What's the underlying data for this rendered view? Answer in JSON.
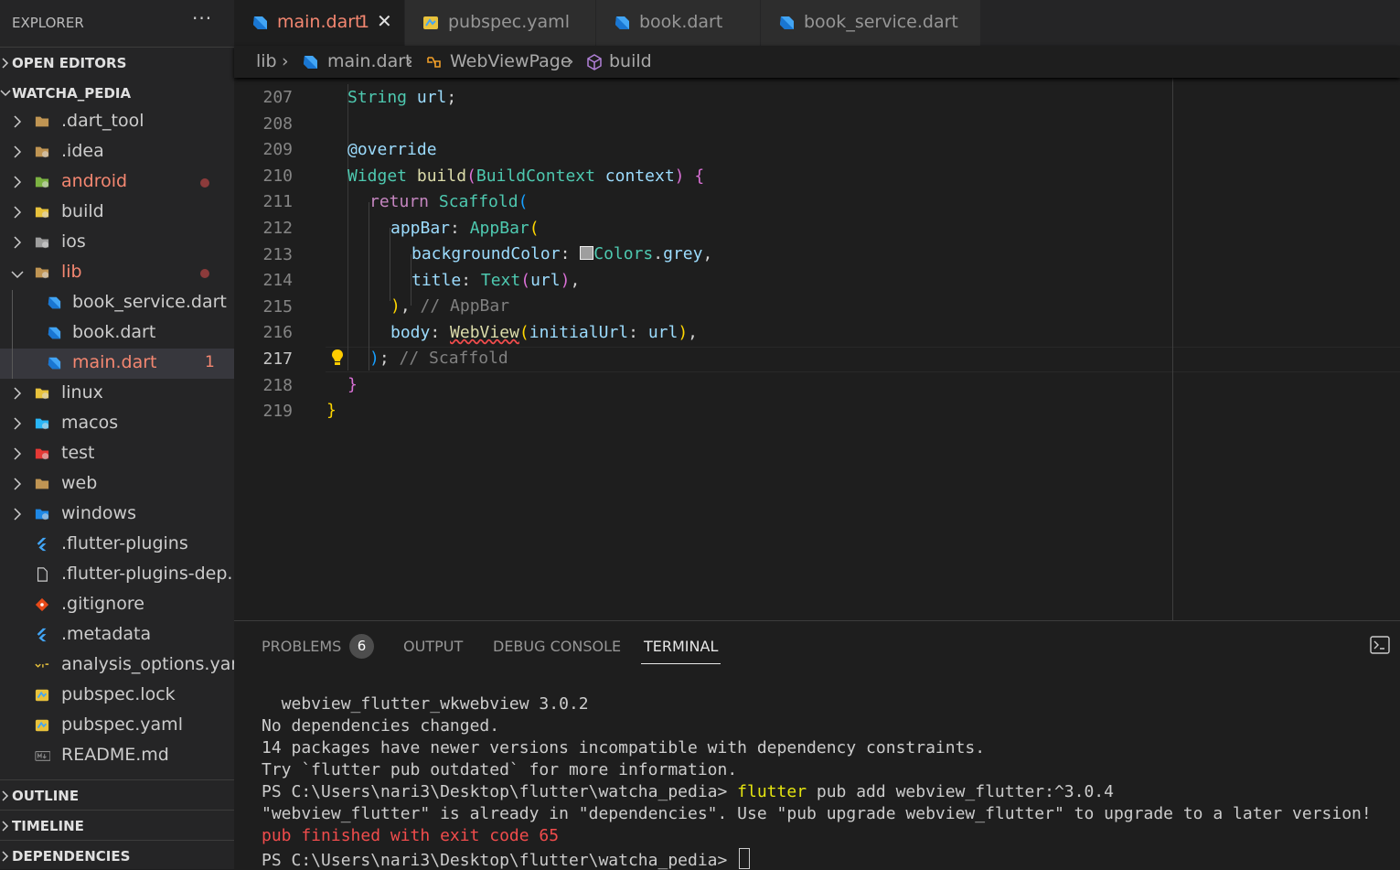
{
  "explorer": {
    "title": "EXPLORER",
    "more": "···",
    "open_editors": "OPEN EDITORS",
    "project": "WATCHA_PEDIA",
    "items": [
      {
        "name": ".dart_tool",
        "kind": "folder",
        "icon": "folder-icon",
        "color": "#c09553"
      },
      {
        "name": ".idea",
        "kind": "folder",
        "icon": "idea-folder-icon",
        "color": "#c09553"
      },
      {
        "name": "android",
        "kind": "folder",
        "icon": "android-folder-icon",
        "color": "#8bc34a",
        "modified": true
      },
      {
        "name": "build",
        "kind": "folder",
        "icon": "build-folder-icon",
        "color": "#e8c23c"
      },
      {
        "name": "ios",
        "kind": "folder",
        "icon": "ios-folder-icon",
        "color": "#9e9e9e"
      },
      {
        "name": "lib",
        "kind": "folder-open",
        "icon": "lib-folder-icon",
        "color": "#c09553",
        "modified": true
      },
      {
        "name": "book_service.dart",
        "kind": "file",
        "icon": "dart-icon"
      },
      {
        "name": "book.dart",
        "kind": "file",
        "icon": "dart-icon"
      },
      {
        "name": "main.dart",
        "kind": "file",
        "icon": "dart-icon",
        "errors": "1"
      },
      {
        "name": "linux",
        "kind": "folder",
        "icon": "linux-folder-icon"
      },
      {
        "name": "macos",
        "kind": "folder",
        "icon": "macos-folder-icon"
      },
      {
        "name": "test",
        "kind": "folder",
        "icon": "test-folder-icon"
      },
      {
        "name": "web",
        "kind": "folder",
        "icon": "web-folder-icon"
      },
      {
        "name": "windows",
        "kind": "folder",
        "icon": "windows-folder-icon"
      },
      {
        "name": ".flutter-plugins",
        "kind": "file",
        "icon": "flutter-icon"
      },
      {
        "name": ".flutter-plugins-dep...",
        "kind": "file",
        "icon": "file-icon"
      },
      {
        "name": ".gitignore",
        "kind": "file",
        "icon": "git-icon"
      },
      {
        "name": ".metadata",
        "kind": "file",
        "icon": "flutter-icon"
      },
      {
        "name": "analysis_options.yaml",
        "kind": "file",
        "icon": "yaml-icon"
      },
      {
        "name": "pubspec.lock",
        "kind": "file",
        "icon": "pubspec-icon"
      },
      {
        "name": "pubspec.yaml",
        "kind": "file",
        "icon": "pubspec-icon"
      },
      {
        "name": "README.md",
        "kind": "file",
        "icon": "markdown-icon"
      }
    ],
    "outline": "OUTLINE",
    "timeline": "TIMELINE",
    "dependencies": "DEPENDENCIES"
  },
  "tabs": [
    {
      "label": "main.dart",
      "badge": "1",
      "icon": "dart-icon",
      "active": true
    },
    {
      "label": "pubspec.yaml",
      "icon": "pubspec-icon"
    },
    {
      "label": "book.dart",
      "icon": "dart-icon"
    },
    {
      "label": "book_service.dart",
      "icon": "dart-icon"
    }
  ],
  "breadcrumb": [
    "lib",
    "main.dart",
    "WebViewPage",
    "build"
  ],
  "editor": {
    "line_numbers": [
      "207",
      "208",
      "209",
      "210",
      "211",
      "212",
      "213",
      "214",
      "215",
      "216",
      "217",
      "218",
      "219"
    ],
    "current_line": "217",
    "lines": [
      "String url;",
      "",
      "@override",
      "Widget build(BuildContext context) {",
      "return Scaffold(",
      "appBar: AppBar(",
      "backgroundColor: Colors.grey,",
      "title: Text(url),",
      "), // AppBar",
      "body: WebView(initialUrl: url),",
      "); // Scaffold",
      "}",
      "}"
    ]
  },
  "panel": {
    "tabs": [
      "PROBLEMS",
      "OUTPUT",
      "DEBUG CONSOLE",
      "TERMINAL"
    ],
    "problems_count": "6",
    "active_tab": "TERMINAL",
    "terminal_lines": [
      "  webview_flutter_wkwebview 3.0.2",
      "No dependencies changed.",
      "14 packages have newer versions incompatible with dependency constraints.",
      "Try `flutter pub outdated` for more information.",
      "PS C:\\Users\\nari3\\Desktop\\flutter\\watcha_pedia> ",
      "flutter",
      " pub add webview_flutter:^3.0.4",
      "\"webview_flutter\" is already in \"dependencies\". Use \"pub upgrade webview_flutter\" to upgrade to a later version!",
      "pub finished with exit code 65",
      "PS C:\\Users\\nari3\\Desktop\\flutter\\watcha_pedia> "
    ]
  },
  "colors": {
    "accent_error": "#f48771",
    "dart_blue": "#42a5f5",
    "background": "#1e1e1e",
    "sidebar": "#252526"
  }
}
